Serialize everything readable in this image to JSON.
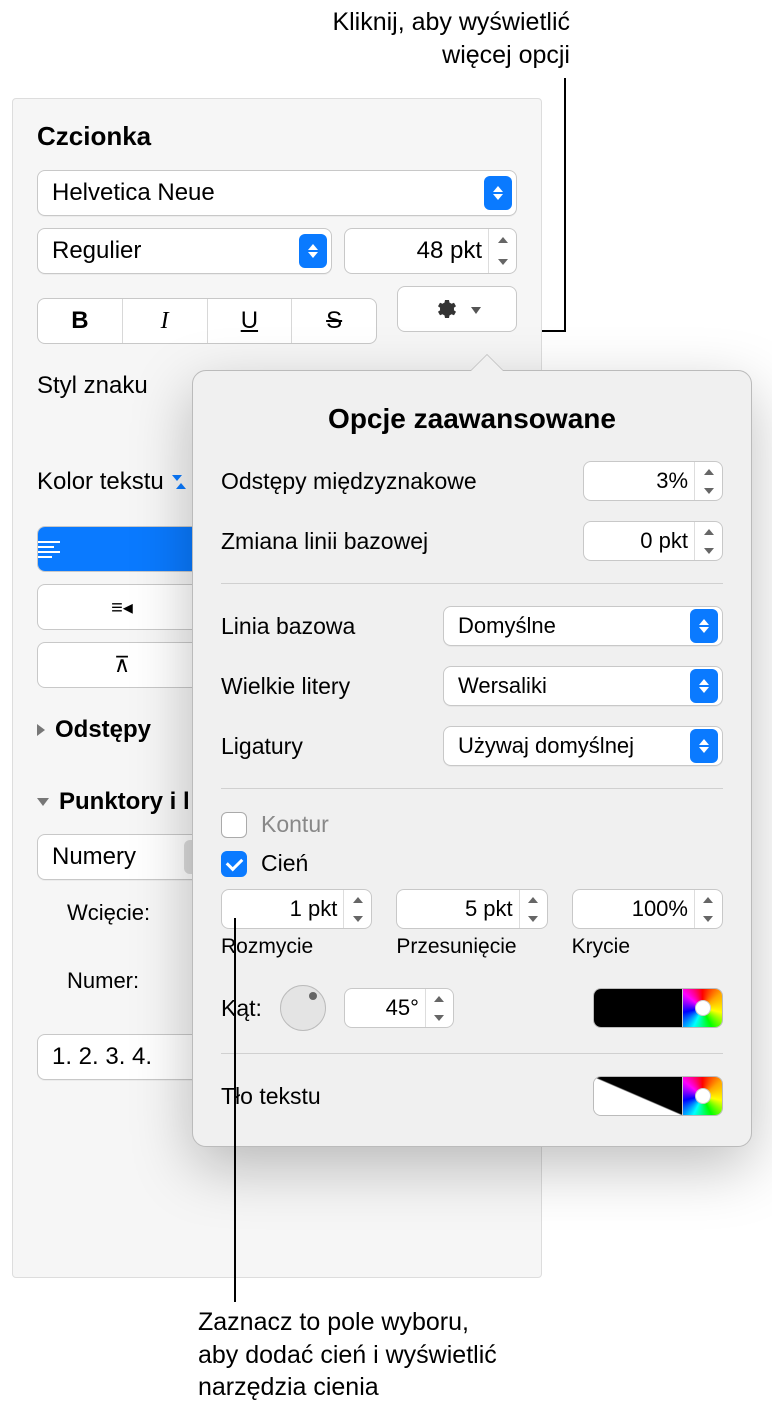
{
  "callouts": {
    "top": "Kliknij, aby wyświetlić\nwięcej opcji",
    "bottom": "Zaznacz to pole wyboru,\naby dodać cień i wyświetlić\nnarzędzia cienia"
  },
  "panel": {
    "section_font": "Czcionka",
    "font_family": "Helvetica Neue",
    "font_style": "Regulier",
    "font_size": "48 pkt",
    "bold": "B",
    "italic": "I",
    "underline": "U",
    "strike": "S",
    "char_style": "Styl znaku",
    "text_color": "Kolor tekstu",
    "spacing": "Odstępy",
    "bullets": "Punktory i l",
    "bullet_style": "Numery",
    "indent_label": "Wcięcie:",
    "number_label": "Numer:",
    "number_format": "1. 2. 3. 4."
  },
  "popover": {
    "title": "Opcje zaawansowane",
    "char_spacing_label": "Odstępy międzyznakowe",
    "char_spacing_value": "3%",
    "baseline_shift_label": "Zmiana linii bazowej",
    "baseline_shift_value": "0 pkt",
    "baseline_label": "Linia bazowa",
    "baseline_value": "Domyślne",
    "caps_label": "Wielkie litery",
    "caps_value": "Wersaliki",
    "ligatures_label": "Ligatury",
    "ligatures_value": "Używaj domyślnej",
    "outline_label": "Kontur",
    "shadow_label": "Cień",
    "blur_value": "1 pkt",
    "blur_label": "Rozmycie",
    "offset_value": "5 pkt",
    "offset_label": "Przesunięcie",
    "opacity_value": "100%",
    "opacity_label": "Krycie",
    "angle_label": "Kąt:",
    "angle_value": "45°",
    "shadow_color": "#000000",
    "text_bg_label": "Tło tekstu"
  }
}
